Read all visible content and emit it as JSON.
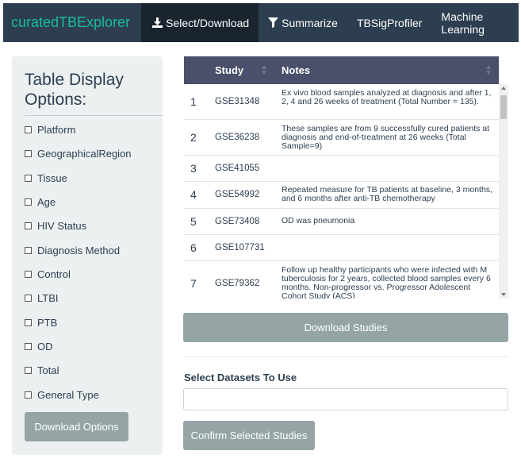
{
  "navbar": {
    "brand": "curatedTBExplorer",
    "items": [
      {
        "label": "Select/Download",
        "icon": "download-icon",
        "active": true
      },
      {
        "label": "Summarize",
        "icon": "filter-icon",
        "active": false
      },
      {
        "label": "TBSigProfiler",
        "icon": "",
        "active": false
      },
      {
        "label": "Machine Learning",
        "icon": "",
        "active": false
      }
    ]
  },
  "sidebar": {
    "title": "Table Display Options:",
    "options": [
      "Platform",
      "GeographicalRegion",
      "Tissue",
      "Age",
      "HIV Status",
      "Diagnosis Method",
      "Control",
      "LTBI",
      "PTB",
      "OD",
      "Total",
      "General Type"
    ],
    "download_button": "Download Options"
  },
  "table": {
    "columns": [
      "Study",
      "Notes"
    ],
    "rows": [
      {
        "n": "1",
        "study": "GSE31348",
        "notes": "Ex vivo blood samples analyzed at diagnosis and after 1, 2, 4 and 26 weeks of treatment (Total Number = 135)."
      },
      {
        "n": "2",
        "study": "GSE36238",
        "notes": "These samples are from 9 successfully cured patients at diagnosis and end-of-treatment at 26 weeks (Total Sample=9)"
      },
      {
        "n": "3",
        "study": "GSE41055",
        "notes": ""
      },
      {
        "n": "4",
        "study": "GSE54992",
        "notes": "Repeated measure for TB patients at baseline, 3 months, and 6 months after anti-TB chemotherapy"
      },
      {
        "n": "5",
        "study": "GSE73408",
        "notes": "OD was pneumonia"
      },
      {
        "n": "6",
        "study": "GSE107731",
        "notes": ""
      },
      {
        "n": "7",
        "study": "GSE79362",
        "notes": "Follow up healthy participants who were infected with M tuberculosis for 2 years, collected blood samples every 6 months. Non-progressor vs. Progressor Adolescent Cohort Study (ACS)"
      }
    ]
  },
  "download_studies_button": "Download Studies",
  "select_datasets": {
    "label": "Select Datasets To Use",
    "value": "",
    "placeholder": ""
  },
  "confirm_button": "Confirm Selected Studies",
  "colors": {
    "navbar": "#2c3e50",
    "brand": "#18bc9c",
    "header": "#4a4f6b",
    "button": "#95a5a6",
    "sidebar": "#ecf0f1"
  }
}
